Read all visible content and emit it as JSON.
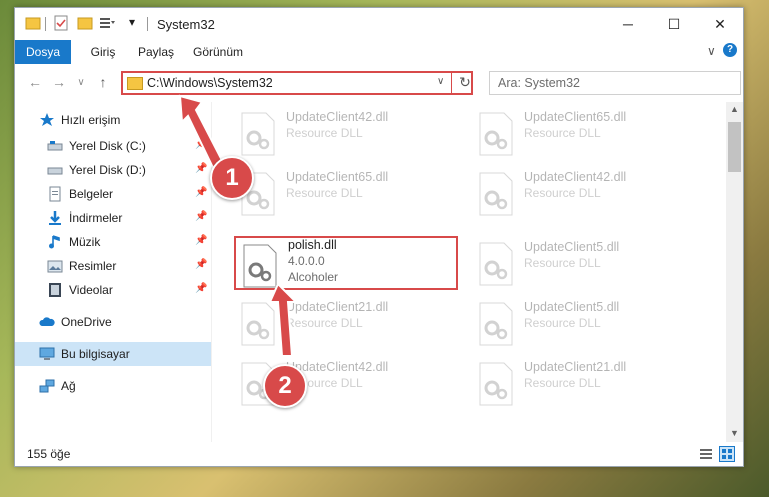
{
  "window": {
    "title": "System32",
    "controls": {
      "minimize": "─",
      "maximize": "☐",
      "close": "✕"
    }
  },
  "ribbon": {
    "tabs": [
      {
        "label": "Dosya",
        "active": true
      },
      {
        "label": "Giriş",
        "active": false
      },
      {
        "label": "Paylaş",
        "active": false
      },
      {
        "label": "Görünüm",
        "active": false
      }
    ],
    "expand_glyph": "∨",
    "help_glyph": "?"
  },
  "navigation": {
    "back_glyph": "←",
    "forward_glyph": "→",
    "recent_glyph": "∨",
    "up_glyph": "↑",
    "address": "C:\\Windows\\System32",
    "refresh_glyph": "↻",
    "search_placeholder": "Ara: System32"
  },
  "sidebar": {
    "quick_access": "Hızlı erişim",
    "items": [
      {
        "label": "Yerel Disk (C:)",
        "icon": "drive-icon",
        "pinned": true
      },
      {
        "label": "Yerel Disk (D:)",
        "icon": "drive-icon",
        "pinned": true
      },
      {
        "label": "Belgeler",
        "icon": "documents-icon",
        "pinned": true
      },
      {
        "label": "İndirmeler",
        "icon": "download-icon",
        "pinned": true
      },
      {
        "label": "Müzik",
        "icon": "music-icon",
        "pinned": true
      },
      {
        "label": "Resimler",
        "icon": "pictures-icon",
        "pinned": true
      },
      {
        "label": "Videolar",
        "icon": "video-icon",
        "pinned": true
      }
    ],
    "onedrive": "OneDrive",
    "this_pc": "Bu bilgisayar",
    "network": "Ağ",
    "pin_glyph": "📌"
  },
  "files": [
    {
      "name": "UpdateClient42.dll",
      "line2": "Resource DLL",
      "line3": "",
      "highlighted": false
    },
    {
      "name": "UpdateClient65.dll",
      "line2": "Resource DLL",
      "line3": "",
      "highlighted": false
    },
    {
      "name": "UpdateClient65.dll",
      "line2": "Resource DLL",
      "line3": "",
      "highlighted": false
    },
    {
      "name": "UpdateClient42.dll",
      "line2": "Resource DLL",
      "line3": "",
      "highlighted": false
    },
    {
      "name": "polish.dll",
      "line2": "4.0.0.0",
      "line3": "Alcoholer",
      "highlighted": true
    },
    {
      "name": "UpdateClient5.dll",
      "line2": "Resource DLL",
      "line3": "",
      "highlighted": false
    },
    {
      "name": "UpdateClient21.dll",
      "line2": "Resource DLL",
      "line3": "",
      "highlighted": false
    },
    {
      "name": "UpdateClient5.dll",
      "line2": "Resource DLL",
      "line3": "",
      "highlighted": false
    },
    {
      "name": "UpdateClient42.dll",
      "line2": "Resource DLL",
      "line3": "",
      "highlighted": false
    },
    {
      "name": "UpdateClient21.dll",
      "line2": "Resource DLL",
      "line3": "",
      "highlighted": false
    }
  ],
  "status": {
    "item_count": "155 öğe"
  },
  "annotations": {
    "step1": "1",
    "step2": "2"
  },
  "colors": {
    "accent": "#1979ca",
    "highlight": "#d84a4a",
    "selected_bg": "#cce4f7"
  }
}
